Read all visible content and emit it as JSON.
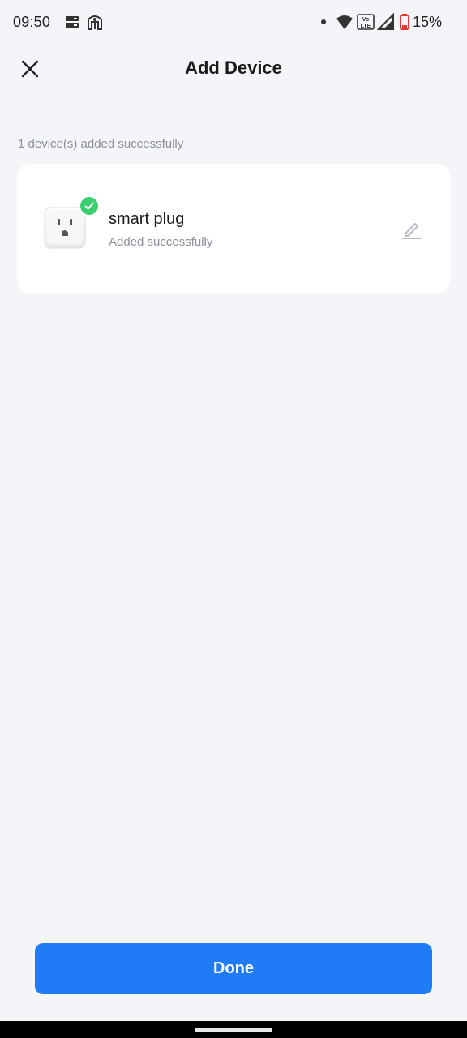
{
  "status_bar": {
    "time": "09:50",
    "battery_percent": "15%",
    "icons": [
      "sim-card-icon",
      "accessibility-icon",
      "dot-icon",
      "wifi-icon",
      "volte-icon",
      "signal-icon",
      "battery-low-icon"
    ]
  },
  "header": {
    "title": "Add Device",
    "close_icon": "close-icon"
  },
  "summary": {
    "text": "1 device(s) added successfully"
  },
  "devices": [
    {
      "name": "smart plug",
      "status": "Added successfully",
      "icon": "smart-plug-icon",
      "badge_icon": "check-icon",
      "edit_icon": "edit-icon"
    }
  ],
  "footer": {
    "done_label": "Done"
  },
  "colors": {
    "background": "#f3f5f9",
    "primary": "#1f7bf6",
    "success": "#3ccf72",
    "muted_text": "#8a8f99"
  }
}
